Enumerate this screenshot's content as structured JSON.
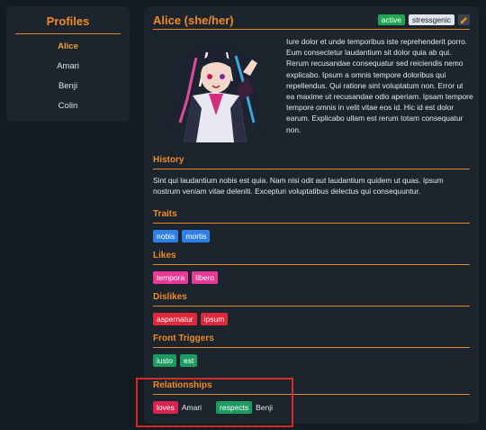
{
  "profiles": {
    "title": "Profiles",
    "items": [
      "Alice",
      "Amari",
      "Benji",
      "Colin"
    ],
    "selected": "Alice"
  },
  "detail": {
    "name": "Alice (she/her)",
    "badges": {
      "active": "active",
      "stress": "stressgenic"
    },
    "edit_icon": "pencil-icon",
    "bio": "Iure dolor et unde temporibus iste reprehenderit porro. Eum consectetur laudantium sit dolor quia ab qui. Rerum recusandae consequatur sed reiciendis nemo explicabo. Ipsum a omnis tempore doloribus qui repellendus. Qui ratione sint voluptatum non. Error ut ea maxime ut recusandae odio aperiam. Ipsam tempore tempore omnis in velit vitae eos id. Hic id est dolor earum. Explicabo ullam est rerum totam consequatur non.",
    "history": {
      "title": "History",
      "text": "Sint qui laudantium nobis est quia. Nam nisi odit aut laudantium quidem ut quas. Ipsum nostrum veniam vitae deleniti. Excepturi voluptatibus delectus qui consequuntur."
    },
    "traits": {
      "title": "Traits",
      "tags": [
        "nobis",
        "mortis"
      ]
    },
    "likes": {
      "title": "Likes",
      "tags": [
        "tempora",
        "libero"
      ]
    },
    "dislikes": {
      "title": "Dislikes",
      "tags": [
        "aspernatur",
        "ipsum"
      ]
    },
    "front_triggers": {
      "title": "Front Triggers",
      "tags": [
        "iusto",
        "est"
      ]
    },
    "relationships": {
      "title": "Relationships",
      "items": [
        {
          "type": "loves",
          "person": "Amari"
        },
        {
          "type": "respects",
          "person": "Benji"
        }
      ]
    }
  },
  "colors": {
    "accent": "#f08a24",
    "background": "#141a21",
    "panel": "#1c252e",
    "highlight": "#d42a2a"
  }
}
